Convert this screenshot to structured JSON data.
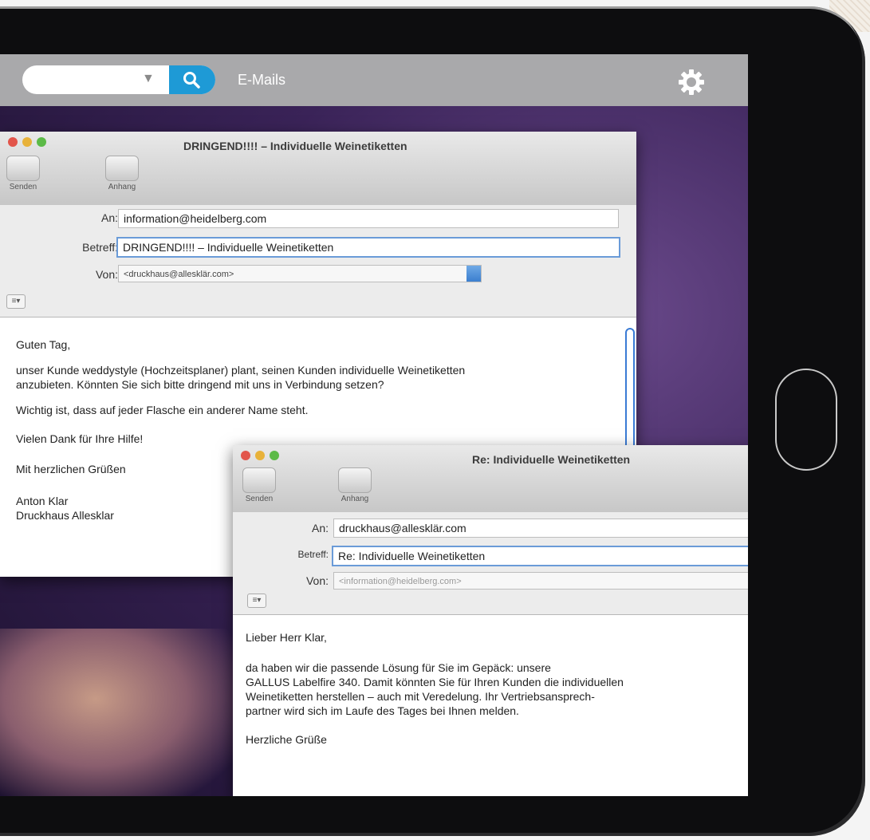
{
  "topbar": {
    "search_placeholder": "",
    "dropdown_arrow": "▼",
    "title": "E-Mails",
    "search_icon": "search-icon",
    "settings_icon": "gear-icon"
  },
  "window1": {
    "title": "DRINGEND!!!! – Individuelle Weinetiketten",
    "toolbar": {
      "send_label": "Senden",
      "attach_label": "Anhang"
    },
    "to_label": "An:",
    "to_value": "information@heidelberg.com",
    "subject_label": "Betreff:",
    "subject_value": "DRINGEND!!!! – Individuelle Weinetiketten",
    "from_label": "Von:",
    "from_value": "<druckhaus@allesklär.com>",
    "format_label": "≡▾",
    "body": [
      "Guten Tag,",
      "unser Kunde weddystyle (Hochzeitsplaner) plant, seinen Kunden individuelle Weinetiketten",
      "anzubieten. Könnten Sie sich bitte dringend mit uns in Verbindung setzen?",
      "Wichtig ist, dass auf jeder Flasche ein anderer Name steht.",
      "Vielen Dank für Ihre Hilfe!",
      "Mit herzlichen Grüßen",
      "Anton Klar",
      "Druckhaus Allesklar"
    ]
  },
  "window2": {
    "title": "Re: Individuelle Weinetiketten",
    "toolbar": {
      "send_label": "Senden",
      "attach_label": "Anhang"
    },
    "to_label": "An:",
    "to_value": "druckhaus@allesklär.com",
    "subject_label": "Betreff:",
    "subject_value": "Re: Individuelle Weinetiketten",
    "from_label": "Von:",
    "from_value": "<information@heidelberg.com>",
    "format_label": "≡▾",
    "body": [
      "Lieber Herr Klar,",
      "da haben wir die passende Lösung für Sie im Gepäck: unsere",
      "GALLUS Labelfire 340. Damit könnten Sie für Ihren Kunden die individuellen",
      "Weinetiketten herstellen – auch mit Veredelung. Ihr Vertriebsansprech-",
      "partner wird sich im Laufe des Tages bei Ihnen melden.",
      "Herzliche Grüße"
    ]
  },
  "colors": {
    "accent": "#1e9ad6",
    "topbar": "#a9a9ab",
    "traffic_red": "#e2554b",
    "traffic_yellow": "#e8b23a",
    "traffic_green": "#5cba47"
  }
}
